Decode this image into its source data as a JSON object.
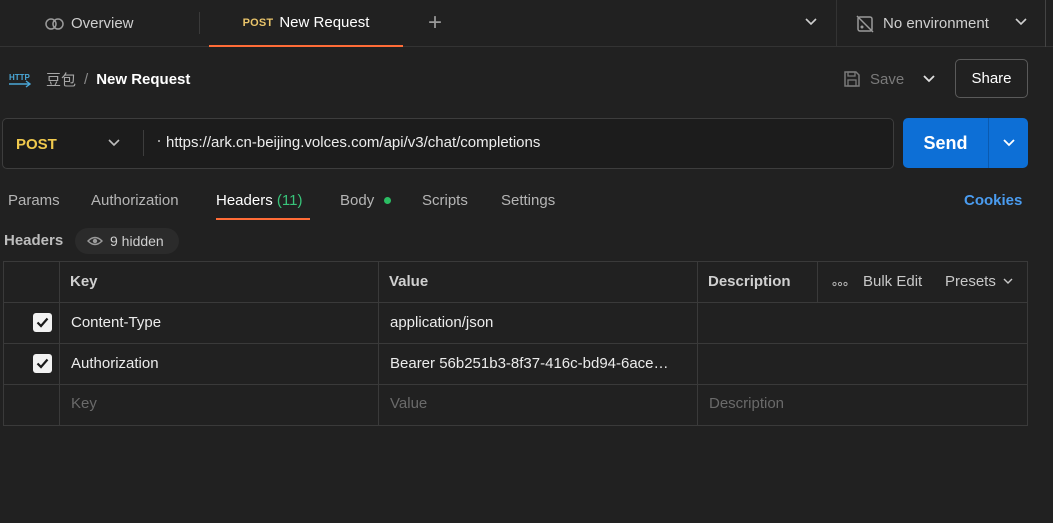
{
  "tabs": {
    "overview": "Overview",
    "active_method": "POST",
    "active_name": "New Request"
  },
  "environment": {
    "label": "No environment"
  },
  "breadcrumb": {
    "parent": "豆包",
    "separator": "/",
    "current": "New Request"
  },
  "actions": {
    "save": "Save",
    "share": "Share"
  },
  "request": {
    "method": "POST",
    "url": "https://ark.cn-beijing.volces.com/api/v3/chat/completions",
    "send": "Send"
  },
  "subtabs": {
    "params": "Params",
    "authorization": "Authorization",
    "headers": "Headers",
    "headers_count": "(11)",
    "body": "Body",
    "scripts": "Scripts",
    "settings": "Settings",
    "cookies": "Cookies"
  },
  "headers_section": {
    "title": "Headers",
    "hidden": "9 hidden"
  },
  "table": {
    "columns": {
      "key": "Key",
      "value": "Value",
      "description": "Description"
    },
    "tools": {
      "bulk_edit": "Bulk Edit",
      "presets": "Presets"
    },
    "rows": [
      {
        "checked": true,
        "key": "Content-Type",
        "value": "application/json",
        "description": ""
      },
      {
        "checked": true,
        "key": "Authorization",
        "value": "Bearer 56b251b3-8f37-416c-bd94-6ace…",
        "description": ""
      }
    ],
    "placeholders": {
      "key": "Key",
      "value": "Value",
      "description": "Description"
    }
  },
  "colors": {
    "accent": "#ff6c37",
    "send": "#0d6fd6",
    "method": "#f0c94d",
    "link": "#4a9cf0",
    "ok": "#38c47a"
  },
  "icons": [
    "overview-icon",
    "plus-icon",
    "chevron-down-icon",
    "no-environment-icon",
    "http-icon",
    "save-icon",
    "eye-icon",
    "checkbox-icon",
    "more-icon"
  ]
}
